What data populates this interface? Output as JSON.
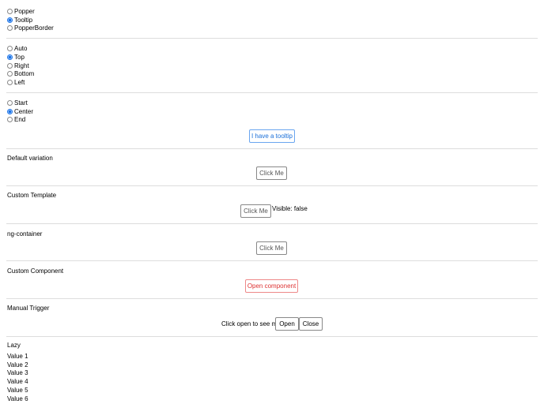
{
  "renderer": {
    "options": [
      {
        "label": "Popper",
        "checked": false
      },
      {
        "label": "Tooltip",
        "checked": true
      },
      {
        "label": "PopperBorder",
        "checked": false
      }
    ]
  },
  "placement": {
    "options": [
      {
        "label": "Auto",
        "checked": false
      },
      {
        "label": "Top",
        "checked": true
      },
      {
        "label": "Right",
        "checked": false
      },
      {
        "label": "Bottom",
        "checked": false
      },
      {
        "label": "Left",
        "checked": false
      }
    ]
  },
  "alignment": {
    "options": [
      {
        "label": "Start",
        "checked": false
      },
      {
        "label": "Center",
        "checked": true
      },
      {
        "label": "End",
        "checked": false
      }
    ]
  },
  "tooltip_button": "I have a tooltip",
  "default_variation": {
    "title": "Default variation",
    "button": "Click Me"
  },
  "custom_template": {
    "title": "Custom Template",
    "button": "Click Me",
    "status": "Visible: false"
  },
  "ng_container": {
    "title": "ng-container",
    "button": "Click Me"
  },
  "custom_component": {
    "title": "Custom Component",
    "button": "Open component"
  },
  "manual_trigger": {
    "title": "Manual Trigger",
    "text": "Click open to see me",
    "open": "Open",
    "close": "Close"
  },
  "lazy": {
    "title": "Lazy",
    "values": [
      "Value 1",
      "Value 2",
      "Value 3",
      "Value 4",
      "Value 5",
      "Value 6"
    ]
  }
}
